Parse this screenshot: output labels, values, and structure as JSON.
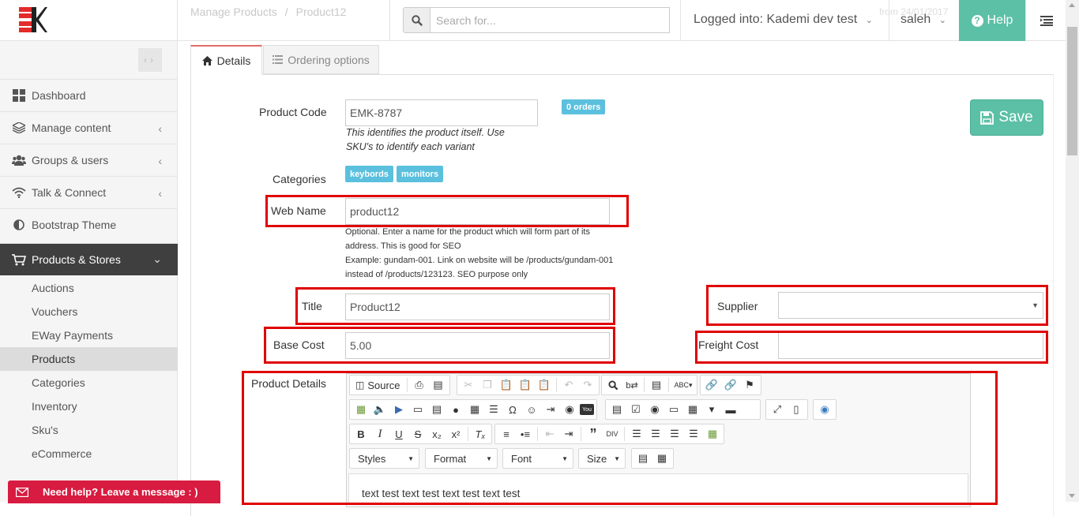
{
  "header": {
    "breadcrumb": [
      "Manage Products",
      "Product12"
    ],
    "search_placeholder": "Search for...",
    "logged_into": "Logged into: Kademi dev test",
    "from_text": "from 24/01/2017",
    "user": "saleh",
    "help_label": "Help"
  },
  "sidebar": {
    "items": [
      {
        "label": "Dashboard",
        "icon": "dashboard-icon"
      },
      {
        "label": "Manage content",
        "icon": "layers-icon"
      },
      {
        "label": "Groups & users",
        "icon": "users-icon"
      },
      {
        "label": "Talk & Connect",
        "icon": "wifi-icon"
      },
      {
        "label": "Bootstrap Theme",
        "icon": "contrast-icon"
      },
      {
        "label": "Products & Stores",
        "icon": "cart-icon"
      }
    ],
    "subitems": [
      "Auctions",
      "Vouchers",
      "EWay Payments",
      "Products",
      "Categories",
      "Inventory",
      "Sku's",
      "eCommerce"
    ]
  },
  "tabs": {
    "details": "Details",
    "ordering": "Ordering options"
  },
  "form": {
    "product_code_label": "Product Code",
    "product_code_value": "EMK-8787",
    "product_code_help_1": "This identifies the product itself. Use",
    "product_code_help_2": "SKU's to identify each variant",
    "orders_badge": "0 orders",
    "categories_label": "Categories",
    "categories": [
      "keybords",
      "monitors"
    ],
    "web_name_label": "Web Name",
    "web_name_value": "product12",
    "web_name_help": [
      "Optional. Enter a name for the product which will form part of its",
      "address. This is good for SEO",
      "Example: gundam-001. Link on website will be /products/gundam-001",
      "instead of /products/123123. SEO purpose only"
    ],
    "title_label": "Title",
    "title_value": "Product12",
    "supplier_label": "Supplier",
    "supplier_value": "",
    "base_cost_label": "Base Cost",
    "base_cost_value": "5.00",
    "freight_cost_label": "Freight Cost",
    "freight_cost_value": "",
    "product_details_label": "Product Details",
    "save_label": "Save"
  },
  "editor": {
    "source_label": "Source",
    "styles_label": "Styles",
    "format_label": "Format",
    "font_label": "Font",
    "size_label": "Size",
    "content": "text test text test text test text test"
  },
  "chat": {
    "label": "Need help? Leave a message : )"
  },
  "colors": {
    "accent": "#5bc0a6",
    "badge": "#5bc0de",
    "highlight_box": "#e00000",
    "chat": "#d81b40",
    "active_nav": "#3f3f3f"
  }
}
